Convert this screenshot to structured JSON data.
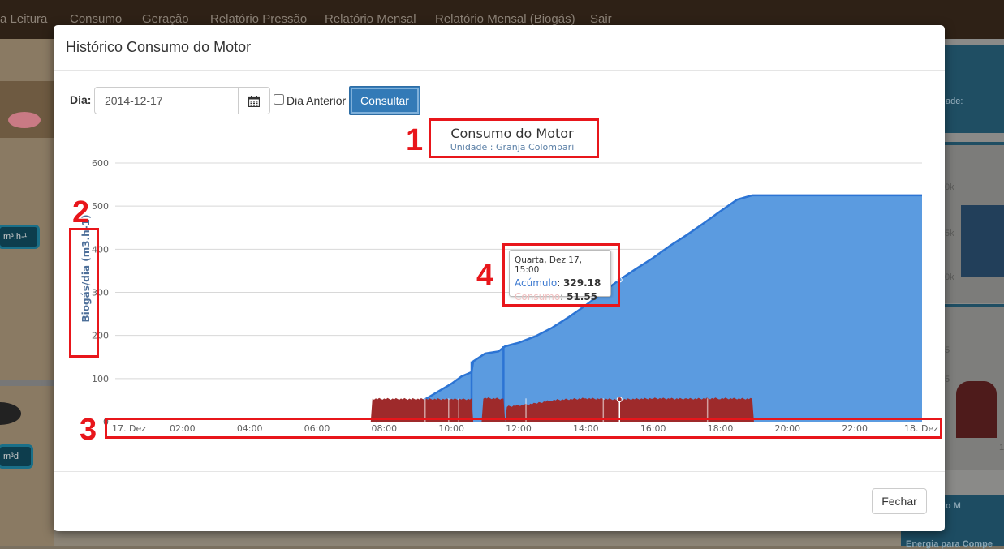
{
  "nav": {
    "items": [
      "a Leitura",
      "Consumo",
      "Geração",
      "Relatório Pressão",
      "Relatório Mensal",
      "Relatório Mensal (Biogás)",
      "Sair"
    ]
  },
  "background": {
    "pill_top": "m³.h-¹",
    "pill_bottom": "m³d",
    "right_label_top": "ade:",
    "right_ticks": [
      "0k",
      "5k",
      "0k",
      "5",
      "5",
      "1"
    ],
    "footer_line1": "amento do M",
    "footer_line2": "Energia para Compe"
  },
  "modal": {
    "title": "Histórico Consumo do Motor",
    "form": {
      "day_label": "Dia:",
      "date_value": "2014-12-17",
      "prev_day_label": "Dia Anterior",
      "prev_day_checked": false,
      "submit_label": "Consultar"
    },
    "close_label": "Fechar"
  },
  "annotations": [
    "1",
    "2",
    "3",
    "4"
  ],
  "chart_data": {
    "type": "area",
    "title": "Consumo do Motor",
    "subtitle": "Unidade : Granja Colombari",
    "ylabel": "Biogás/dia (m3.h-1)",
    "xlabel": "",
    "ylim": [
      0,
      600
    ],
    "yticks": [
      0,
      100,
      200,
      300,
      400,
      500,
      600
    ],
    "xticks": [
      "17. Dez",
      "02:00",
      "04:00",
      "06:00",
      "08:00",
      "10:00",
      "12:00",
      "14:00",
      "16:00",
      "18:00",
      "20:00",
      "22:00",
      "18. Dez"
    ],
    "x_range_hours": [
      0,
      24
    ],
    "grid": true,
    "series": [
      {
        "name": "Acúmulo",
        "color": "#5b9be0",
        "points": [
          [
            7.75,
            0
          ],
          [
            8.0,
            5
          ],
          [
            8.5,
            22
          ],
          [
            9.0,
            42
          ],
          [
            9.5,
            65
          ],
          [
            10.0,
            88
          ],
          [
            10.3,
            105
          ],
          [
            10.6,
            115
          ],
          [
            10.65,
            140
          ],
          [
            11.0,
            158
          ],
          [
            11.4,
            163
          ],
          [
            11.6,
            175
          ],
          [
            12.0,
            183
          ],
          [
            12.5,
            198
          ],
          [
            13.0,
            218
          ],
          [
            13.5,
            243
          ],
          [
            14.0,
            270
          ],
          [
            14.5,
            300
          ],
          [
            15.0,
            329.18
          ],
          [
            15.5,
            355
          ],
          [
            16.0,
            380
          ],
          [
            16.5,
            408
          ],
          [
            17.0,
            433
          ],
          [
            17.5,
            460
          ],
          [
            18.0,
            488
          ],
          [
            18.5,
            515
          ],
          [
            18.95,
            525
          ],
          [
            24,
            525
          ]
        ]
      },
      {
        "name": "Consumo",
        "color": "#9e2a2b",
        "points": [
          [
            7.6,
            0
          ],
          [
            7.65,
            53
          ],
          [
            10.6,
            52
          ],
          [
            10.65,
            0
          ],
          [
            10.9,
            0
          ],
          [
            10.95,
            55
          ],
          [
            11.55,
            53
          ],
          [
            11.6,
            0
          ],
          [
            11.65,
            35
          ],
          [
            12.5,
            42
          ],
          [
            13.0,
            50
          ],
          [
            14.0,
            54
          ],
          [
            15.0,
            51.55
          ],
          [
            16.0,
            54
          ],
          [
            17.0,
            53
          ],
          [
            18.0,
            54
          ],
          [
            18.95,
            53
          ],
          [
            19.0,
            0
          ]
        ]
      }
    ],
    "tooltip": {
      "date": "Quarta, Dez 17, 15:00",
      "rows": [
        {
          "name": "Acúmulo",
          "value": "329.18"
        },
        {
          "name": "Consumo",
          "value": "51.55"
        }
      ]
    }
  }
}
